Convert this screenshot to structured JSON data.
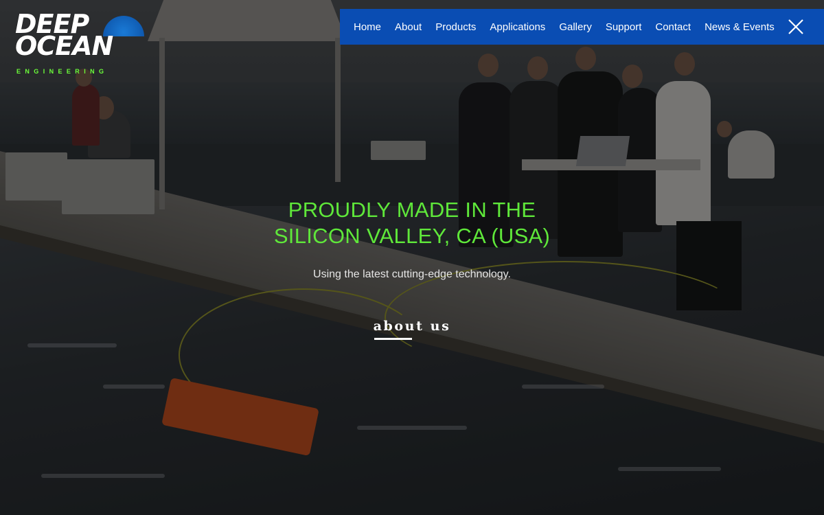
{
  "logo": {
    "line1": "DEEP",
    "line2": "OCEAN",
    "tagline": "ENGINEERING"
  },
  "nav": {
    "items": [
      {
        "label": "Home"
      },
      {
        "label": "About"
      },
      {
        "label": "Products"
      },
      {
        "label": "Applications"
      },
      {
        "label": "Gallery"
      },
      {
        "label": "Support"
      },
      {
        "label": "Contact"
      },
      {
        "label": "News & Events"
      }
    ],
    "close_icon": "close-icon"
  },
  "hero": {
    "headline_line1": "PROUDLY MADE IN THE",
    "headline_line2": "SILICON VALLEY, CA (USA)",
    "subline": "Using the latest cutting-edge technology.",
    "cta_label": "about us"
  },
  "colors": {
    "nav_background": "#0a4db3",
    "headline": "#5fe83a",
    "logo_accent": "#6cff3a"
  }
}
